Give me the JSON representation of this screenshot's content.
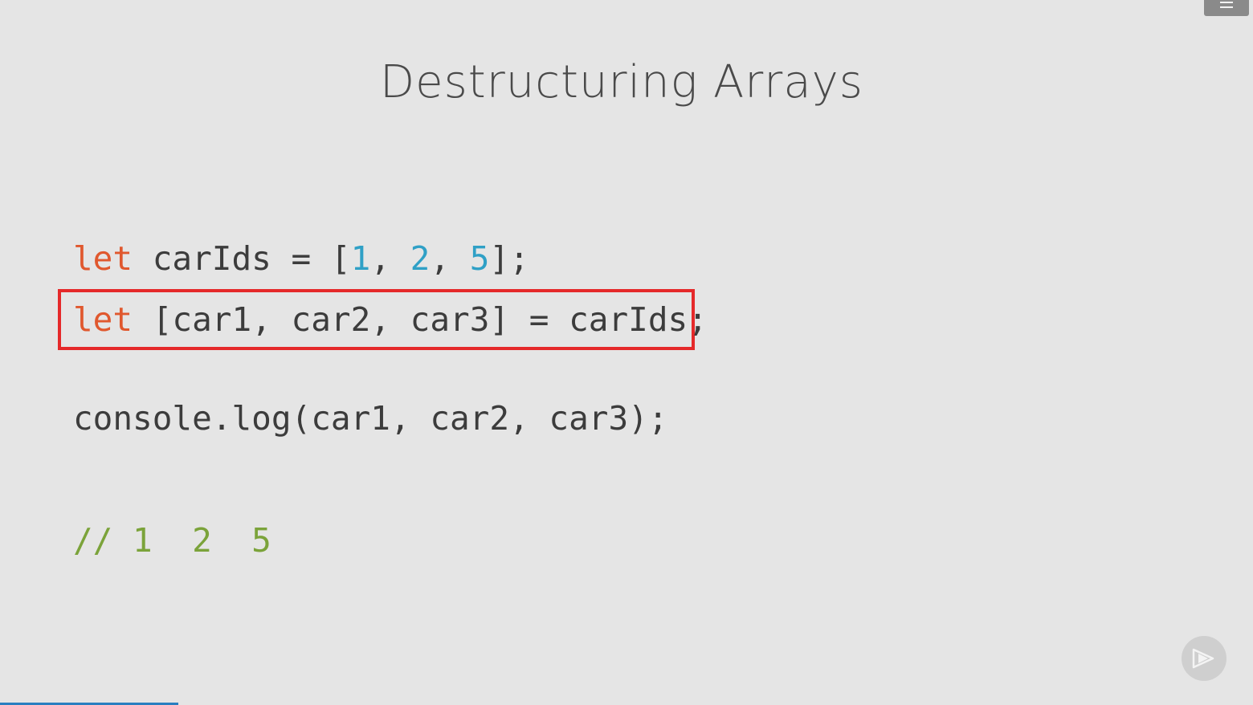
{
  "slide": {
    "title": "Destructuring Arrays",
    "code": {
      "line1": {
        "keyword": "let",
        "part1": " carIds = [",
        "n1": "1",
        "sep1": ", ",
        "n2": "2",
        "sep2": ", ",
        "n3": "5",
        "part2": "];"
      },
      "line2": {
        "keyword": "let",
        "rest": " [car1, car2, car3] = carIds;"
      },
      "line3": "console.log(car1, car2, car3);",
      "line4": "// 1  2  5"
    }
  },
  "player": {
    "menu_icon": "hamburger-icon",
    "logo_icon": "play-logo-icon",
    "progress": 0.142
  },
  "colors": {
    "keyword": "#e0582e",
    "number": "#2fa0c6",
    "comment": "#7ba33a",
    "highlight": "#e5292a",
    "progress": "#2a7fc0"
  }
}
